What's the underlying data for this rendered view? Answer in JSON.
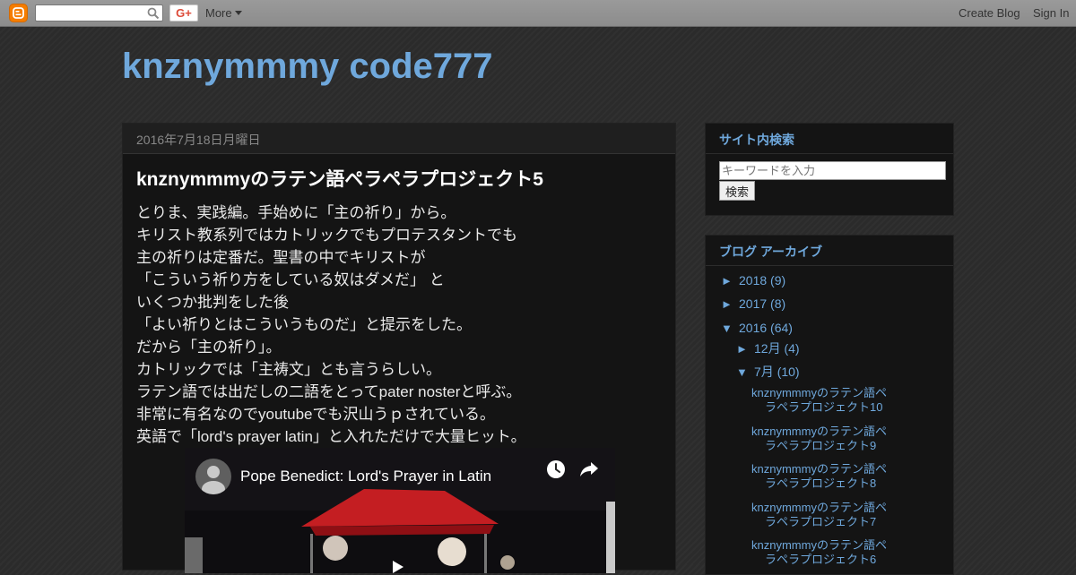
{
  "navbar": {
    "search_placeholder": "",
    "gplus_label": "G+",
    "more_label": "More",
    "create_blog": "Create Blog",
    "sign_in": "Sign In"
  },
  "blog": {
    "title": "knznymmmy code777"
  },
  "post": {
    "date": "2016年7月18日月曜日",
    "title": "knznymmmyのラテン語ペラペラプロジェクト5",
    "lines": [
      "とりま、実践編。手始めに「主の祈り」から。",
      "キリスト教系列ではカトリックでもプロテスタントでも",
      "主の祈りは定番だ。聖書の中でキリストが",
      "「こういう祈り方をしている奴はダメだ」 と",
      "いくつか批判をした後",
      "「よい祈りとはこういうものだ」と提示をした。",
      "だから「主の祈り」。",
      "カトリックでは「主祷文」とも言うらしい。",
      "ラテン語では出だしの二語をとってpater nosterと呼ぶ。",
      "非常に有名なのでyoutubeでも沢山うｐされている。",
      "英語で「lord's prayer latin」と入れただけで大量ヒット。"
    ],
    "video": {
      "title": "Pope Benedict: Lord's Prayer in Latin"
    }
  },
  "sidebar": {
    "search": {
      "title": "サイト内検索",
      "placeholder": "キーワードを入力",
      "button": "検索"
    },
    "archive": {
      "title": "ブログ アーカイブ",
      "years": [
        {
          "toggle": "►",
          "label": "2018",
          "count": "(9)"
        },
        {
          "toggle": "►",
          "label": "2017",
          "count": "(8)"
        },
        {
          "toggle": "▼",
          "label": "2016",
          "count": "(64)"
        }
      ],
      "months": [
        {
          "toggle": "►",
          "label": "12月",
          "count": "(4)"
        },
        {
          "toggle": "▼",
          "label": "7月",
          "count": "(10)"
        }
      ],
      "posts": [
        {
          "line1": "knznymmmyのラテン語ペ",
          "line2": "ラペラプロジェクト10"
        },
        {
          "line1": "knznymmmyのラテン語ペ",
          "line2": "ラペラプロジェクト9"
        },
        {
          "line1": "knznymmmyのラテン語ペ",
          "line2": "ラペラプロジェクト8"
        },
        {
          "line1": "knznymmmyのラテン語ペ",
          "line2": "ラペラプロジェクト7"
        },
        {
          "line1": "knznymmmyのラテン語ペ",
          "line2": "ラペラプロジェクト6"
        }
      ]
    }
  }
}
